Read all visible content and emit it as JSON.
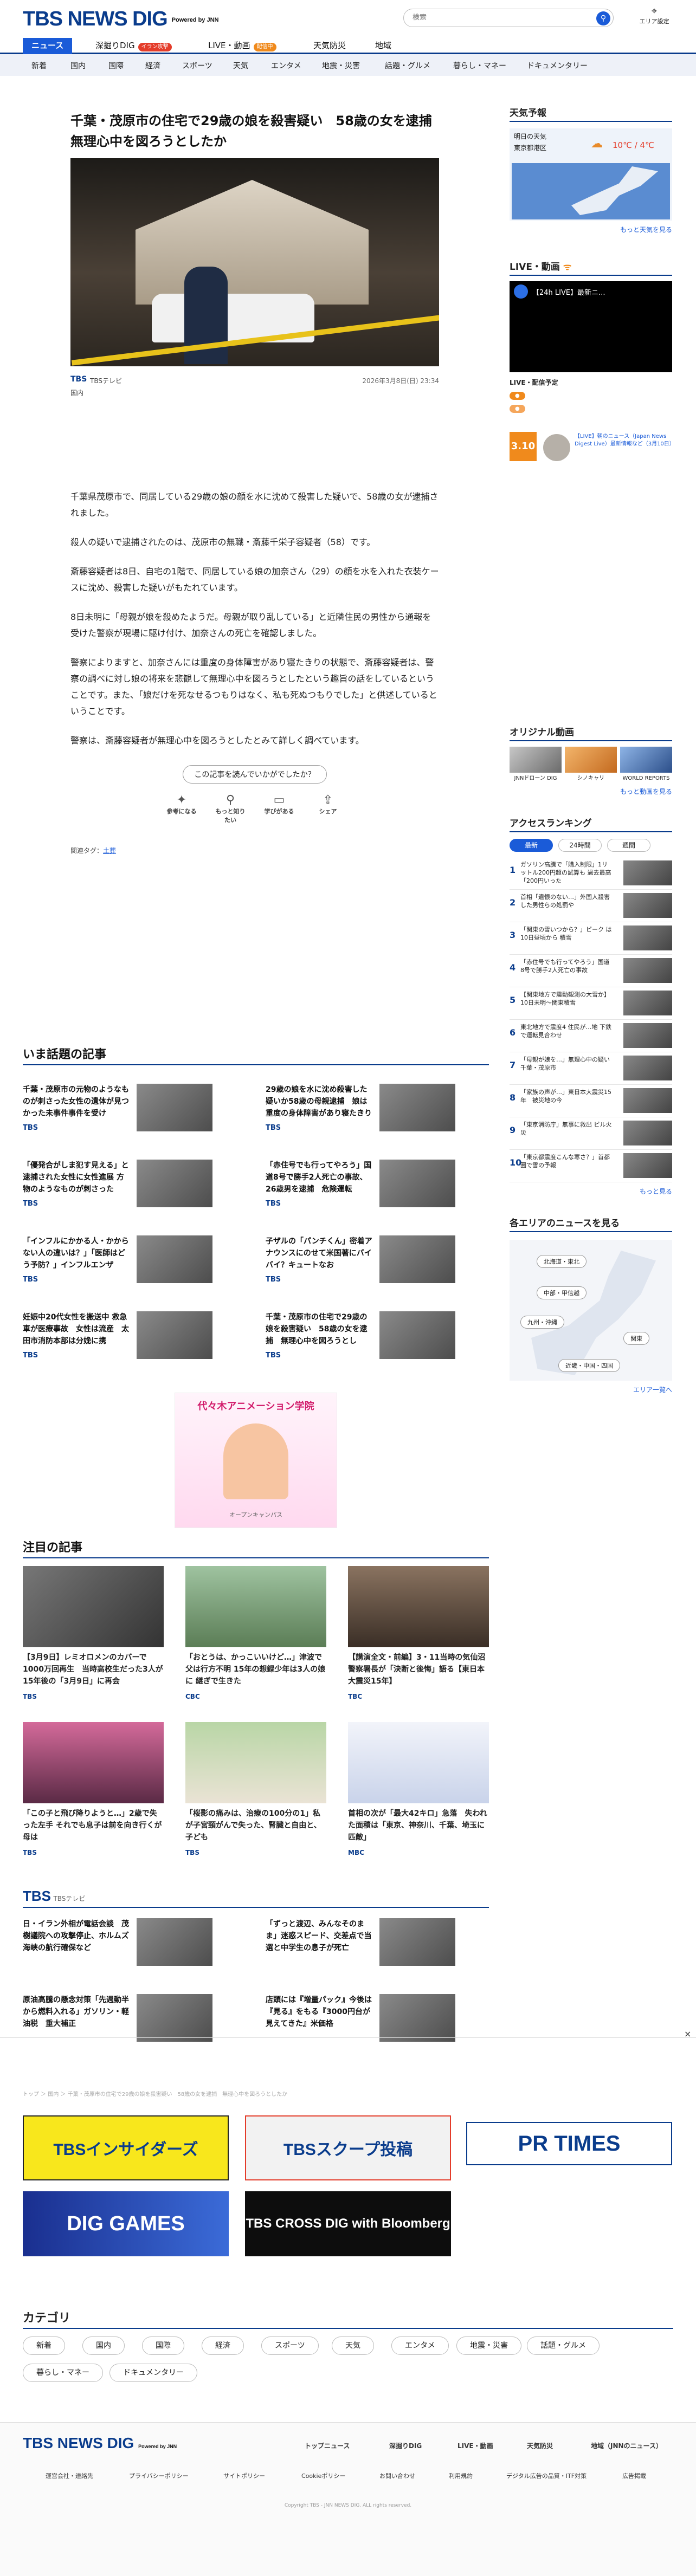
{
  "header": {
    "logo": "TBS NEWS DIG",
    "powered": "Powered by JNN",
    "search_placeholder": "検索",
    "area_label": "エリア設定"
  },
  "gnav": [
    {
      "label": "ニュース",
      "active": true
    },
    {
      "label": "深掘りDIG",
      "tag": "イラン攻撃"
    },
    {
      "label": "LIVE・動画",
      "tag": "配信中"
    },
    {
      "label": "天気防災"
    },
    {
      "label": "地域"
    }
  ],
  "subnav": [
    "新着",
    "国内",
    "国際",
    "経済",
    "スポーツ",
    "天気",
    "エンタメ",
    "地震・災害",
    "話題・グルメ",
    "暮らし・マネー",
    "ドキュメンタリー"
  ],
  "article": {
    "title": "千葉・茂原市の住宅で29歳の娘を殺害疑い　58歳の女を逮捕　無理心中を図ろうとしたか",
    "source_logo": "TBS",
    "source": "TBSテレビ",
    "date": "2026年3月8日(日) 23:34",
    "category": "国内",
    "paragraphs": [
      "千葉県茂原市で、同居している29歳の娘の顔を水に沈めて殺害した疑いで、58歳の女が逮捕されました。",
      "殺人の疑いで逮捕されたのは、茂原市の無職・斎藤千栄子容疑者（58）です。",
      "斎藤容疑者は8日、自宅の1階で、同居している娘の加奈さん（29）の顔を水を入れた衣装ケースに沈め、殺害した疑いがもたれています。",
      "8日未明に「母親が娘を殺めたようだ。母親が取り乱している」と近隣住民の男性から通報を受けた警察が現場に駆け付け、加奈さんの死亡を確認しました。",
      "警察によりますと、加奈さんには重度の身体障害があり寝たきりの状態で、斎藤容疑者は、警察の調べに対し娘の将来を悲観して無理心中を図ろうとしたという趣旨の話をしているということです。また、「娘だけを死なせるつもりはなく、私も死ぬつもりでした」と供述しているということです。",
      "警察は、斎藤容疑者が無理心中を図ろうとしたとみて詳しく調べています。"
    ],
    "feedback_q": "この記事を読んでいかがでしたか？",
    "feedback": [
      "参考になる",
      "もっと知りたい",
      "学びがある",
      "シェア"
    ],
    "tags_label": "関連タグ：",
    "tag": "土葬"
  },
  "hot": {
    "title": "いま話題の記事",
    "items": [
      {
        "t": "千葉・茂原市の元物のようなものが刺さった女性の遺体が見つかった未事件事件を受け",
        "s": "TBS"
      },
      {
        "t": "29歳の娘を水に沈め殺害した疑いか58歳の母親逮捕　娘は重度の身体障害があり寝たきりの状",
        "s": "TBS"
      },
      {
        "t": "「優発合がしま犯す見える」と逮捕された女性に女性進展 方物のようなものが刺さった",
        "s": "TBS"
      },
      {
        "t": "「赤住号でも行ってやろう」国道8号で勝手2人死亡の事故、26歳男を逮捕　危険運転",
        "s": "TBS"
      },
      {
        "t": "「インフルにかかる人・かからない人の違いは？」「医師はどう予防？」インフルエンザ",
        "s": "TBS"
      },
      {
        "t": "子ザルの「パンチくん」密着アナウンスにのせて米国著にバイバイ？キュートなお",
        "s": "TBS"
      },
      {
        "t": "妊娠中20代女性を搬送中 救急車が医療事故　女性は流産　太田市消防本部は分娩に携",
        "s": "TBS"
      },
      {
        "t": "千葉・茂原市の住宅で29歳の娘を殺害疑い　58歳の女を逮捕　無理心中を図ろうとし",
        "s": "TBS"
      }
    ]
  },
  "ad": {
    "label": "オープンキャンパス",
    "title": "代々木アニメーション学院"
  },
  "featured": {
    "title": "注目の記事",
    "items": [
      {
        "t": "【3月9日】レミオロメンのカバーで1000万回再生　当時高校生だった3人が15年後の「3月9日」に再会",
        "s": "TBS"
      },
      {
        "t": "「おとうは、かっこいいけど…」津波で父は行方不明 15年の想録少年は3人の娘に 継ぎで生きた",
        "s": "CBC"
      },
      {
        "t": "【講演全文・前編】3・11当時の気仙沼警察署長が「決断と後悔」語る【東日本大震災15年】",
        "s": "TBC"
      },
      {
        "t": "「この子と飛び降りようと…」2歳で失った左手 それでも息子は前を向き行くが 母は",
        "s": "TBS"
      },
      {
        "t": "「桜影の痛みは、治療の100分の1」私が子宮頸がんで失った、腎臓と自由と、子ども",
        "s": "TBS"
      },
      {
        "t": "首相の次が「最大42キロ」急落　失われた面積は「東京、神奈川、千葉、埼玉に匹敵」",
        "s": "MBC"
      }
    ]
  },
  "tbs": {
    "title": "TBS",
    "sub": "TBSテレビ",
    "items": [
      {
        "t": "日・イラン外相が電話会談　茂樹議院への攻撃停止、ホルムズ海峡の航行確保など",
        "s": "TBS"
      },
      {
        "t": "「ずっと渡辺、みんなそのまま」迷惑スピード、交差点で当選と中学生の息子が死亡",
        "s": "TBS"
      },
      {
        "t": "原油高騰の懸念対策「先週動半から燃料入れる」ガソリン・軽油税　重大補正",
        "s": "TBS"
      },
      {
        "t": "店頭には『増量パック』今後は『見る』をもる『3000円台が見えてきた』米価格",
        "s": "TBS"
      }
    ]
  },
  "breadcrumb": "トップ ＞ 国内 ＞ 千葉・茂原市の住宅で29歳の娘を殺害疑い　58歳の女を逮捕　無理心中を図ろうとしたか",
  "banners": [
    "TBSインサイダーズ",
    "TBSスクープ投稿",
    "PR TIMES",
    "DIG GAMES",
    "TBS CROSS DIG with Bloomberg"
  ],
  "categories": {
    "title": "カテゴリ",
    "items": [
      "新着",
      "国内",
      "国際",
      "経済",
      "スポーツ",
      "天気",
      "エンタメ",
      "地震・災害",
      "話題・グルメ",
      "暮らし・マネー",
      "ドキュメンタリー"
    ]
  },
  "right": {
    "weather_title": "天気予報",
    "weather_day": "明日の天気",
    "weather_place": "東京都港区",
    "weather_temp": "10℃ / 4℃",
    "weather_more": "もっと天気を見る",
    "live_title": "LIVE・動画",
    "live_video": "【24h LIVE】最新ニ...",
    "live_schedule": "LIVE・配信予定",
    "live_time": "3.10",
    "live_text": "【LIVE】朝のニュース（Japan News Digest Live）最新情報など（3月10日）",
    "orig_title": "オリジナル動画",
    "orig": [
      "JNNドローン DIG",
      "シノキャリ",
      "WORLD REPORTS"
    ],
    "orig_more": "もっと動画を見る",
    "rank_title": "アクセスランキング",
    "rank_tabs": [
      "最新",
      "24時間",
      "週間"
    ],
    "ranks": [
      "ガソリン高騰で「購入制限」1リットル200円超の試算も 過去最高「200円いった",
      "首相「遺恨のない…」外国人殺害した男性らの処罰や",
      "「関東の雪いつから？」ピーク は10日昼頃から 積雪",
      "「赤住号でも行ってやろう」国道8号で勝手2人死亡の事故",
      "【関東地方で震動観測の大雪か】10日未明〜関東積雪",
      "東北地方で震度4 住民が…地 下鉄で運転見合わせ",
      "「母親が娘を…」無理心中の疑い 千葉・茂原市",
      "「家族の声が…」東日本大震災15年　被災地の今",
      "「東京消防庁」無事に救出 ビル火災",
      "「東京都震度こんな寒さ？」首都圏で雪の予報"
    ],
    "rank_more": "もっと見る",
    "region_title": "各エリアのニュースを見る",
    "regions": [
      "北海道・東北",
      "中部・甲信越",
      "九州・沖縄",
      "関東",
      "近畿・中国・四国"
    ],
    "region_more": "エリア一覧へ"
  },
  "footer": {
    "logo": "TBS NEWS DIG",
    "powered": "Powered by JNN",
    "nav": [
      "トップニュース",
      "深掘りDIG",
      "LIVE・動画",
      "天気防災",
      "地域（JNNのニュース）"
    ],
    "links": [
      "運営会社・連絡先",
      "プライバシーポリシー",
      "サイトポリシー",
      "Cookieポリシー",
      "お問い合わせ",
      "利用規約",
      "デジタル広告の品質・ITF対策",
      "広告掲載"
    ],
    "copyright": "Copyright TBS - JNN NEWS DIG. ALL rights reserved."
  }
}
